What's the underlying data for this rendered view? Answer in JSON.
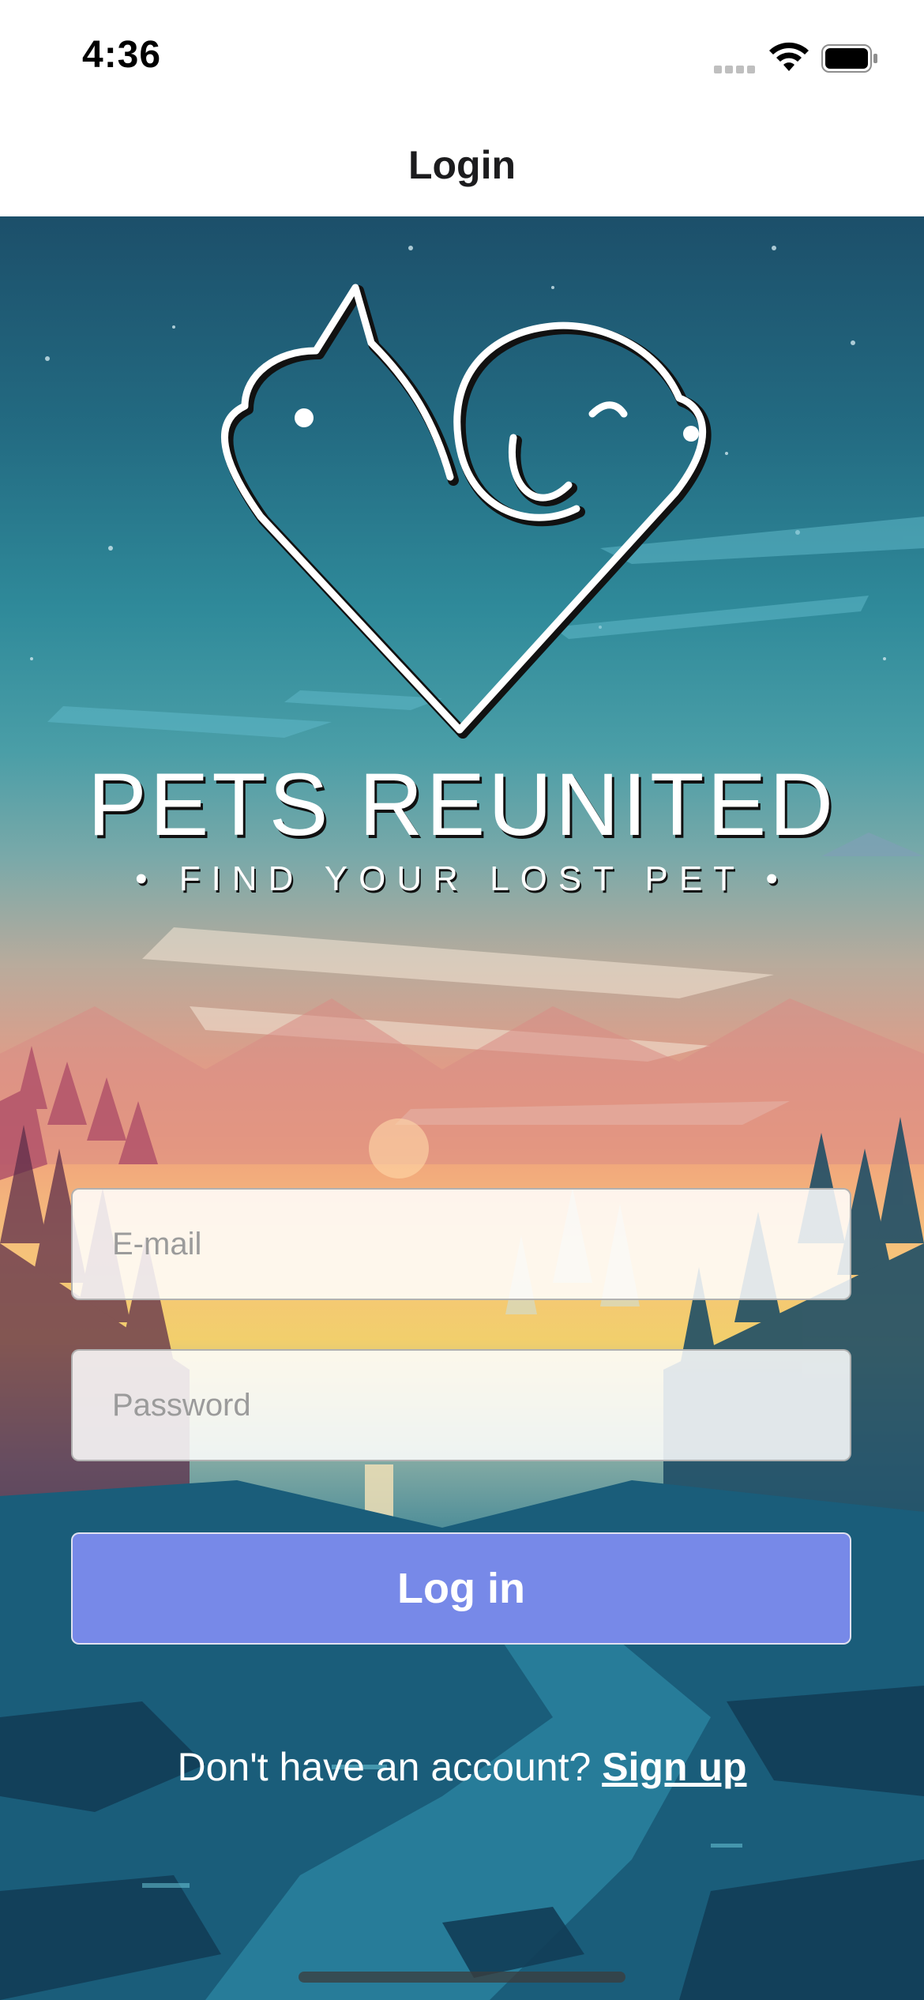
{
  "status_bar": {
    "time": "4:36"
  },
  "nav": {
    "title": "Login"
  },
  "brand": {
    "title": "PETS REUNITED",
    "tagline": "• FIND YOUR LOST PET •"
  },
  "form": {
    "email_placeholder": "E-mail",
    "email_value": "",
    "password_placeholder": "Password",
    "password_value": "",
    "login_label": "Log in"
  },
  "signup": {
    "prompt": "Don't have an account? ",
    "link_label": "Sign up"
  },
  "icons": {
    "signal": "cellular-signal-icon",
    "wifi": "wifi-icon",
    "battery": "battery-icon",
    "logo": "pet-heart-logo"
  },
  "colors": {
    "login_button": "#7789e8",
    "nav_background": "#ffffff"
  }
}
